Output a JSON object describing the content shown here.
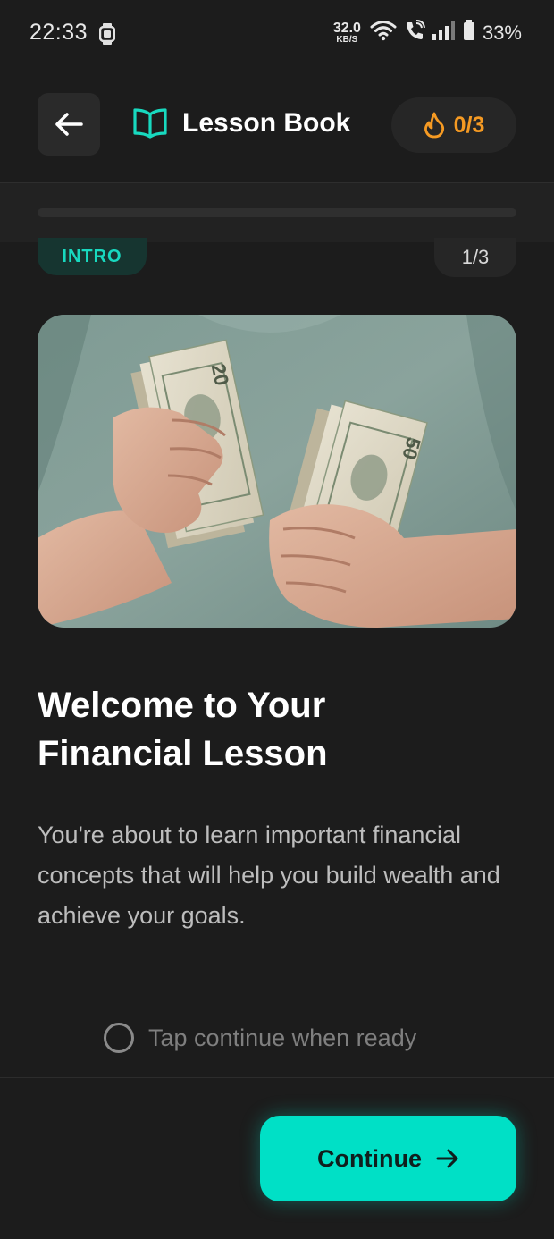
{
  "status_bar": {
    "time": "22:33",
    "data_speed": "32.0",
    "data_unit": "KB/S",
    "battery": "33%"
  },
  "header": {
    "title": "Lesson Book",
    "streak": "0/3"
  },
  "progress": {
    "fraction": 0.0
  },
  "lesson": {
    "tag": "INTRO",
    "step": "1/3",
    "heading_line1": "Welcome to Your",
    "heading_line2": "Financial Lesson",
    "body": "You're about to learn important financial concepts that will help you build wealth and achieve your goals.",
    "hint": "Tap continue when ready"
  },
  "footer": {
    "continue_label": "Continue"
  },
  "colors": {
    "accent": "#00e0c6",
    "streak": "#f59a23",
    "background": "#1c1c1c"
  },
  "icons": {
    "back": "arrow-left-icon",
    "book": "open-book-icon",
    "streak": "flame-icon",
    "continue": "arrow-right-icon"
  }
}
